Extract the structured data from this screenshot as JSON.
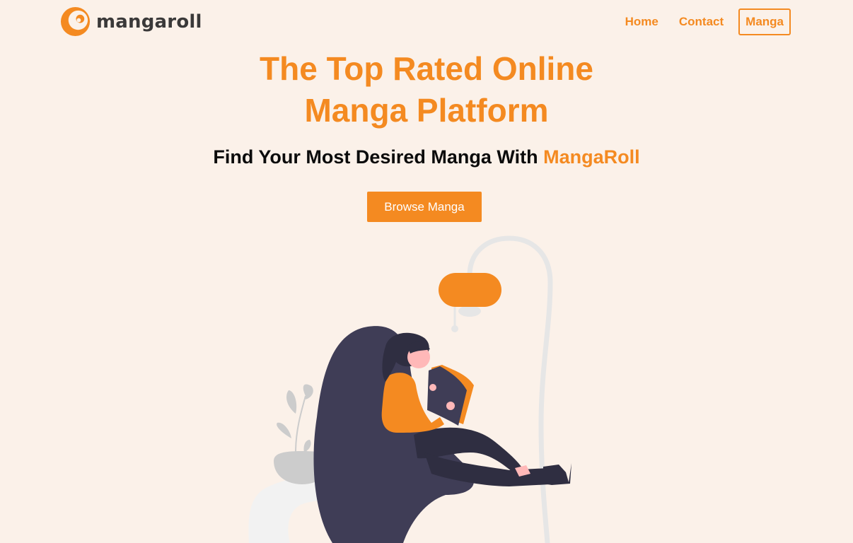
{
  "header": {
    "logo_text": "mangaroll",
    "logo_icon": "crescent-logo-icon",
    "nav": {
      "home": "Home",
      "contact": "Contact",
      "manga": "Manga"
    }
  },
  "hero": {
    "title_line1": "The Top Rated Online",
    "title_line2": "Manga Platform",
    "subtitle_prefix": "Find Your Most Desired Manga With ",
    "subtitle_brand": "MangaRoll",
    "cta_label": "Browse Manga"
  },
  "colors": {
    "accent": "#f48a21",
    "background": "#fbf1e9",
    "dark": "#3f3d56"
  }
}
